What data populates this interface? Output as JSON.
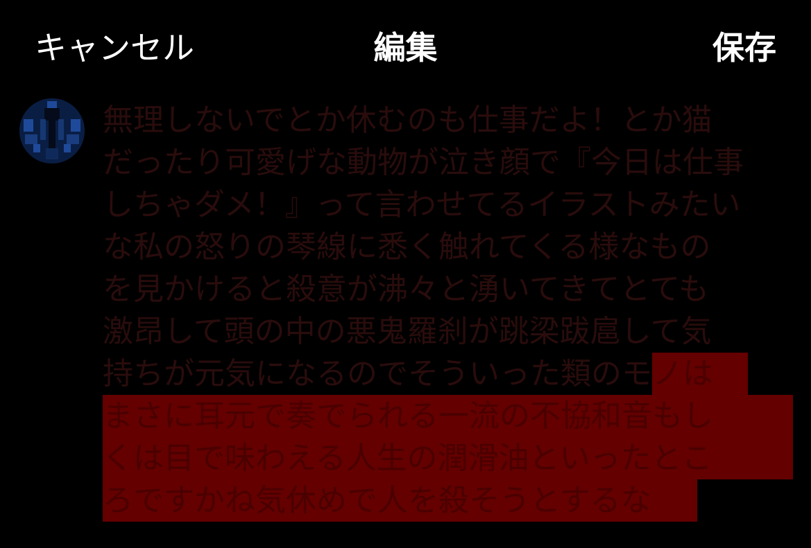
{
  "header": {
    "cancel_label": "キャンセル",
    "title": "編集",
    "save_label": "保存"
  },
  "editor": {
    "lines": [
      "無理しないでとか休むのも仕事だよ！とか猫",
      "だったり可愛げな動物が泣き顔で『今日は仕事",
      "しちゃダメ！』って言わせてるイラストみたい",
      "な私の怒りの琴線に悉く触れてくる様なもの",
      "を見かけると殺意が沸々と湧いてきてとても",
      "激昂して頭の中の悪鬼羅刹が跳梁跋扈して気",
      "持ちが元気になるのでそういった類のモ",
      "ノは",
      "まさに耳元で奏でられる一流の不協和音もし",
      "くは目で味わえる人生の潤滑油といったとこ",
      "ろですかね気休めで人を殺そうとするな"
    ]
  },
  "colors": {
    "background": "#000000",
    "header_text": "#ffffff",
    "body_text": "#2a0c0c",
    "selection": "#640000",
    "avatar_bg": "#0a1e44"
  },
  "icons": {
    "avatar": "user-avatar-pixel"
  }
}
